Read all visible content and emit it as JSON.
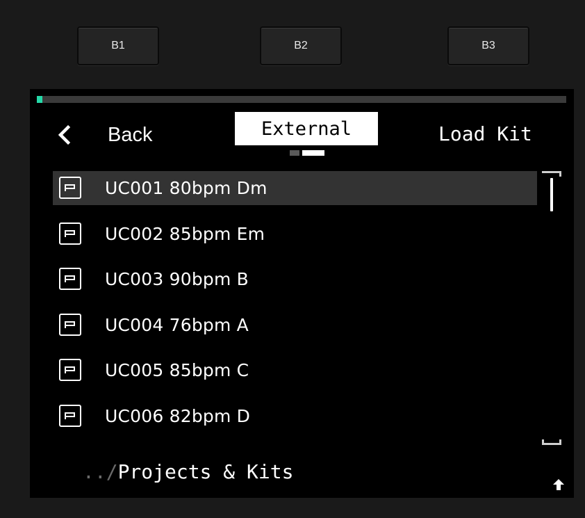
{
  "hardware_buttons": [
    {
      "label": "B1"
    },
    {
      "label": "B2"
    },
    {
      "label": "B3"
    }
  ],
  "header": {
    "back_label": "Back",
    "active_tab": "External",
    "action_label": "Load Kit",
    "page_count": 2,
    "active_page": 2
  },
  "progress": {
    "value": 0.01,
    "color": "#25d9a8"
  },
  "list": {
    "items": [
      {
        "label": "UC001 80bpm Dm",
        "icon": "preset-icon",
        "selected": true
      },
      {
        "label": "UC002 85bpm Em",
        "icon": "preset-icon",
        "selected": false
      },
      {
        "label": "UC003 90bpm B",
        "icon": "preset-icon",
        "selected": false
      },
      {
        "label": "UC004 76bpm A",
        "icon": "preset-icon",
        "selected": false
      },
      {
        "label": "UC005 85bpm C",
        "icon": "preset-icon",
        "selected": false
      },
      {
        "label": "UC006 82bpm D",
        "icon": "preset-icon",
        "selected": false
      }
    ]
  },
  "footer": {
    "path_prefix": "../",
    "path_name": "Projects & Kits",
    "up_icon": "arrow-up-icon"
  },
  "colors": {
    "accent": "#25d9a8",
    "selected_row": "#333333",
    "screen_bg": "#000000"
  }
}
